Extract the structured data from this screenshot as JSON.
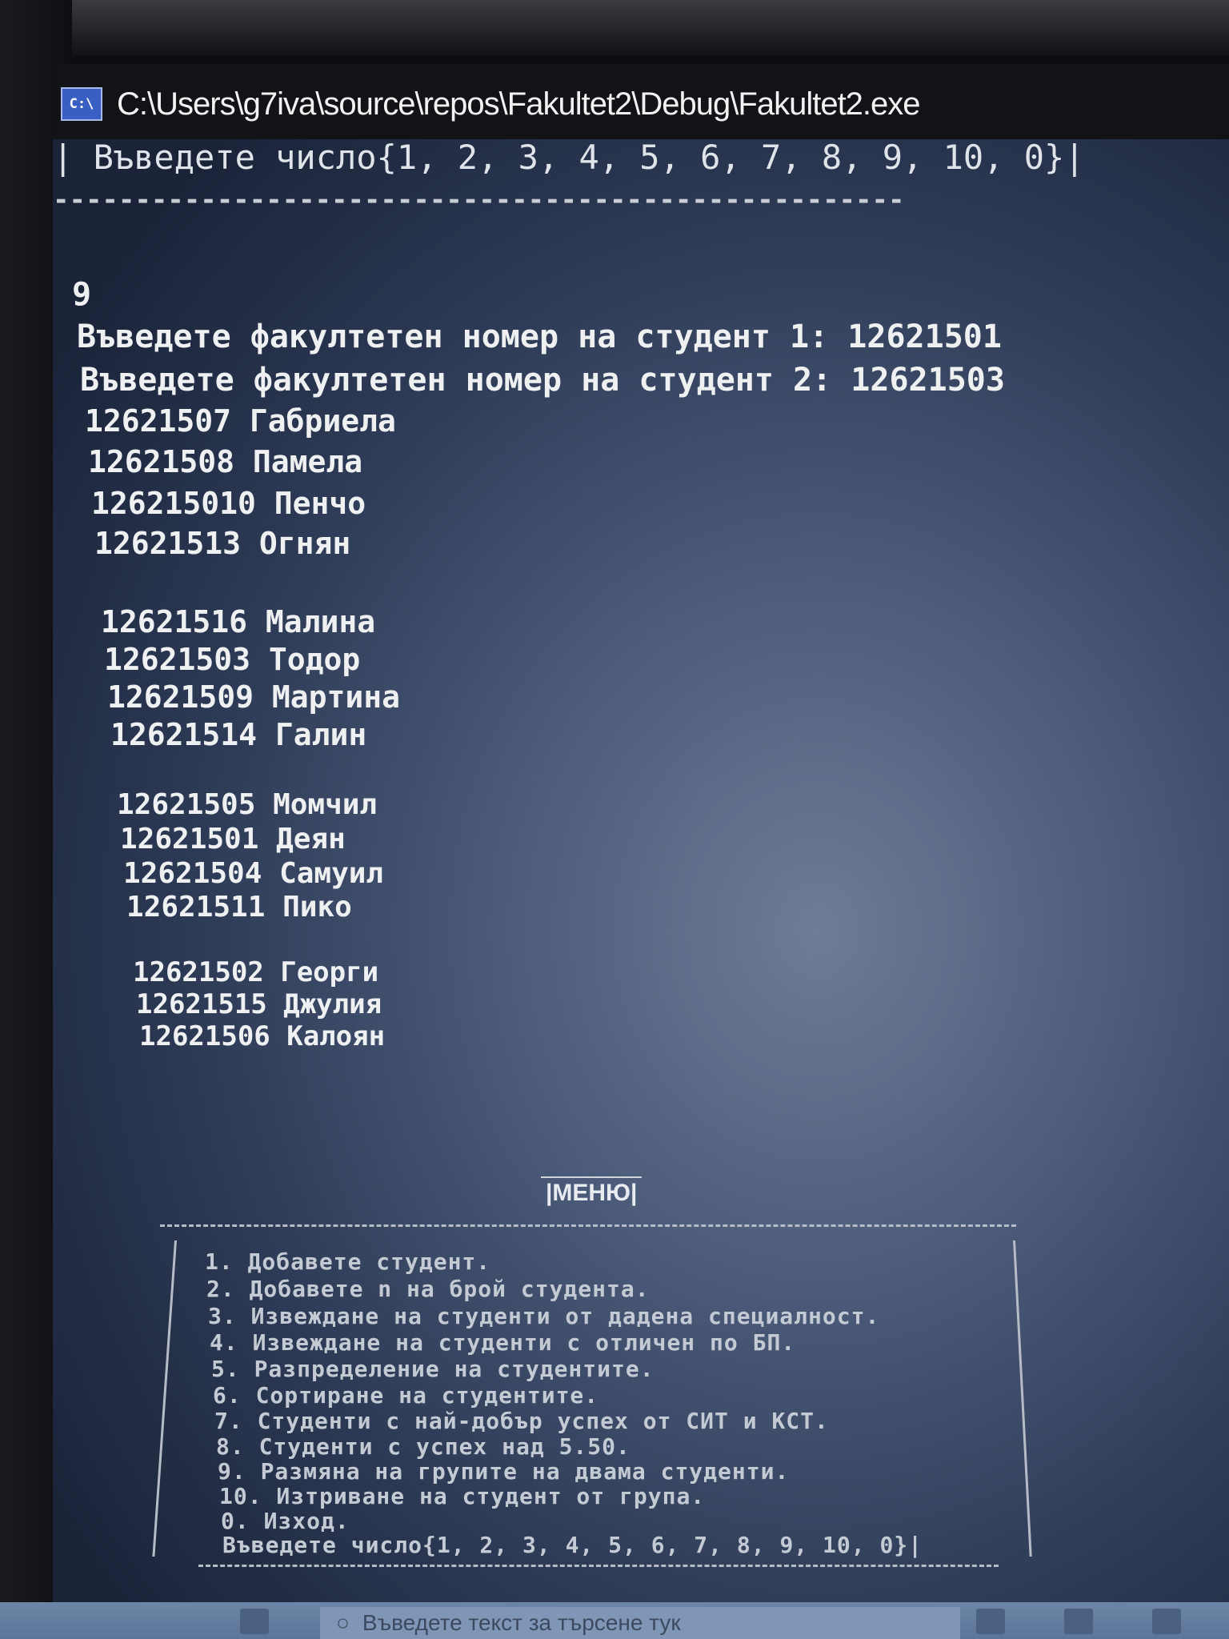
{
  "window": {
    "title": "C:\\Users\\g7iva\\source\\repos\\Fakultet2\\Debug\\Fakultet2.exe",
    "icon_text": "C:\\"
  },
  "console": {
    "top_prompt": "| Въведете число{1, 2, 3, 4, 5, 6, 7, 8, 9, 10, 0}|",
    "separator": "----------------------------------------------------",
    "input_value": "9",
    "faculty_prompts": [
      "Въведете факултетен номер на студент 1: 12621501",
      "Въведете факултетен номер на студент 2: 12621503"
    ],
    "groups": [
      [
        "12621507 Габриела",
        "12621508 Памела",
        "126215010 Пенчо",
        "12621513 Огнян"
      ],
      [
        "12621516 Малина",
        "12621503 Тодор",
        "12621509 Мартина",
        "12621514 Галин"
      ],
      [
        "12621505 Момчил",
        "12621501 Деян",
        "12621504 Самуил",
        "12621511 Пико"
      ],
      [
        "12621502 Георги",
        "12621515 Джулия",
        "12621506 Калоян"
      ]
    ]
  },
  "menu": {
    "title": "|МЕНЮ|",
    "items": [
      "1. Добавете студент.",
      "2. Добавете n на брой студента.",
      "3. Извеждане на студенти от дадена специалност.",
      "4. Извеждане на студенти с отличен по БП.",
      "5. Разпределение на студентите.",
      "6. Сортиране на студентите.",
      "7. Студенти с най-добър успех от СИТ и КСТ.",
      "8. Студенти с успех над 5.50.",
      "9. Размяна на групите на двама студенти.",
      "10. Изтриване на студент от група.",
      "0. Изход.",
      "Въведете число{1, 2, 3, 4, 5, 6, 7, 8, 9, 10, 0}|"
    ]
  },
  "taskbar": {
    "search_placeholder": "Въведете текст за търсене тук"
  }
}
